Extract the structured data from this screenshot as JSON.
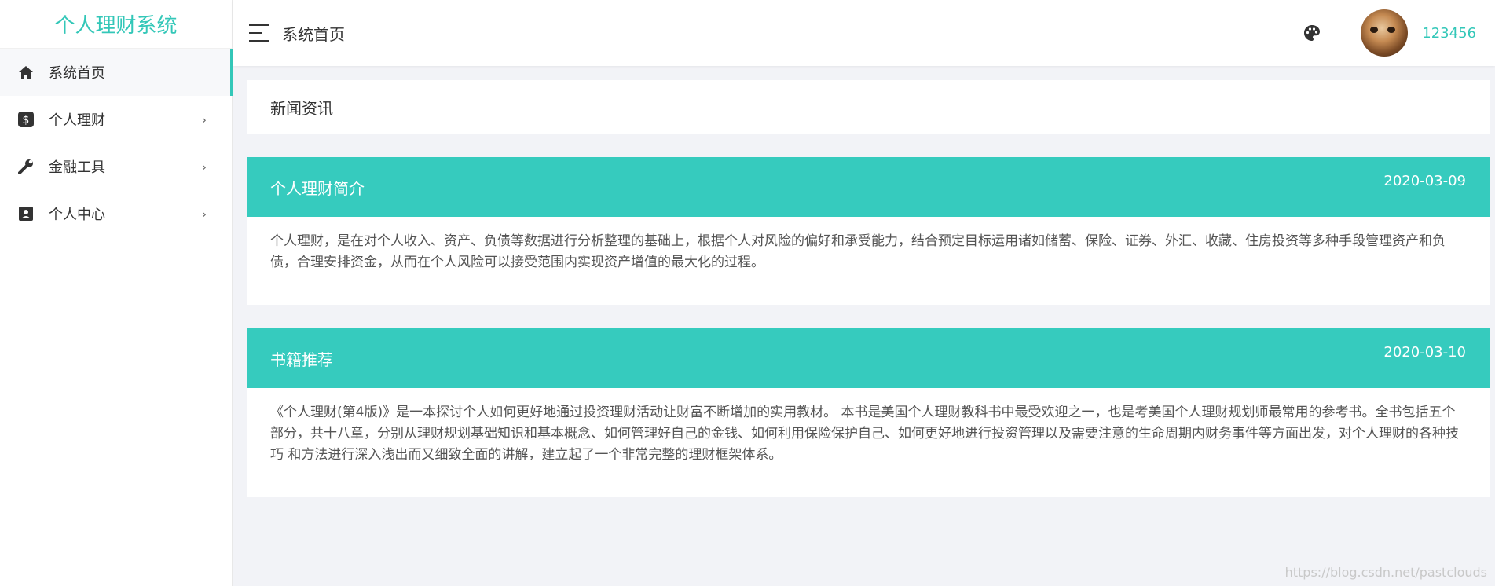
{
  "brand": "个人理财系统",
  "sidebar": {
    "items": [
      {
        "label": "系统首页",
        "icon": "home-icon",
        "active": true
      },
      {
        "label": "个人理财",
        "icon": "dollar-icon",
        "chevron": "›"
      },
      {
        "label": "金融工具",
        "icon": "wrench-icon",
        "chevron": "›"
      },
      {
        "label": "个人中心",
        "icon": "contact-card-icon",
        "chevron": "›"
      }
    ]
  },
  "header": {
    "title": "系统首页",
    "username": "123456"
  },
  "main": {
    "news_title": "新闻资讯",
    "cards": [
      {
        "title": "个人理财简介",
        "date": "2020-03-09",
        "body": "个人理财，是在对个人收入、资产、负债等数据进行分析整理的基础上，根据个人对风险的偏好和承受能力，结合预定目标运用诸如储蓄、保险、证券、外汇、收藏、住房投资等多种手段管理资产和负债，合理安排资金，从而在个人风险可以接受范围内实现资产增值的最大化的过程。"
      },
      {
        "title": "书籍推荐",
        "date": "2020-03-10",
        "body": "《个人理财(第4版)》是一本探讨个人如何更好地通过投资理财活动让财富不断增加的实用教材。 本书是美国个人理财教科书中最受欢迎之一，也是考美国个人理财规划师最常用的参考书。全书包括五个部分，共十八章，分别从理财规划基础知识和基本概念、如何管理好自己的金钱、如何利用保险保护自己、如何更好地进行投资管理以及需要注意的生命周期内财务事件等方面出发，对个人理财的各种技巧 和方法进行深入浅出而又细致全面的讲解，建立起了一个非常完整的理财框架体系。"
      }
    ]
  },
  "watermark": "https://blog.csdn.net/pastclouds",
  "colors": {
    "accent": "#33c7b8",
    "card_header": "#36cbbe"
  }
}
